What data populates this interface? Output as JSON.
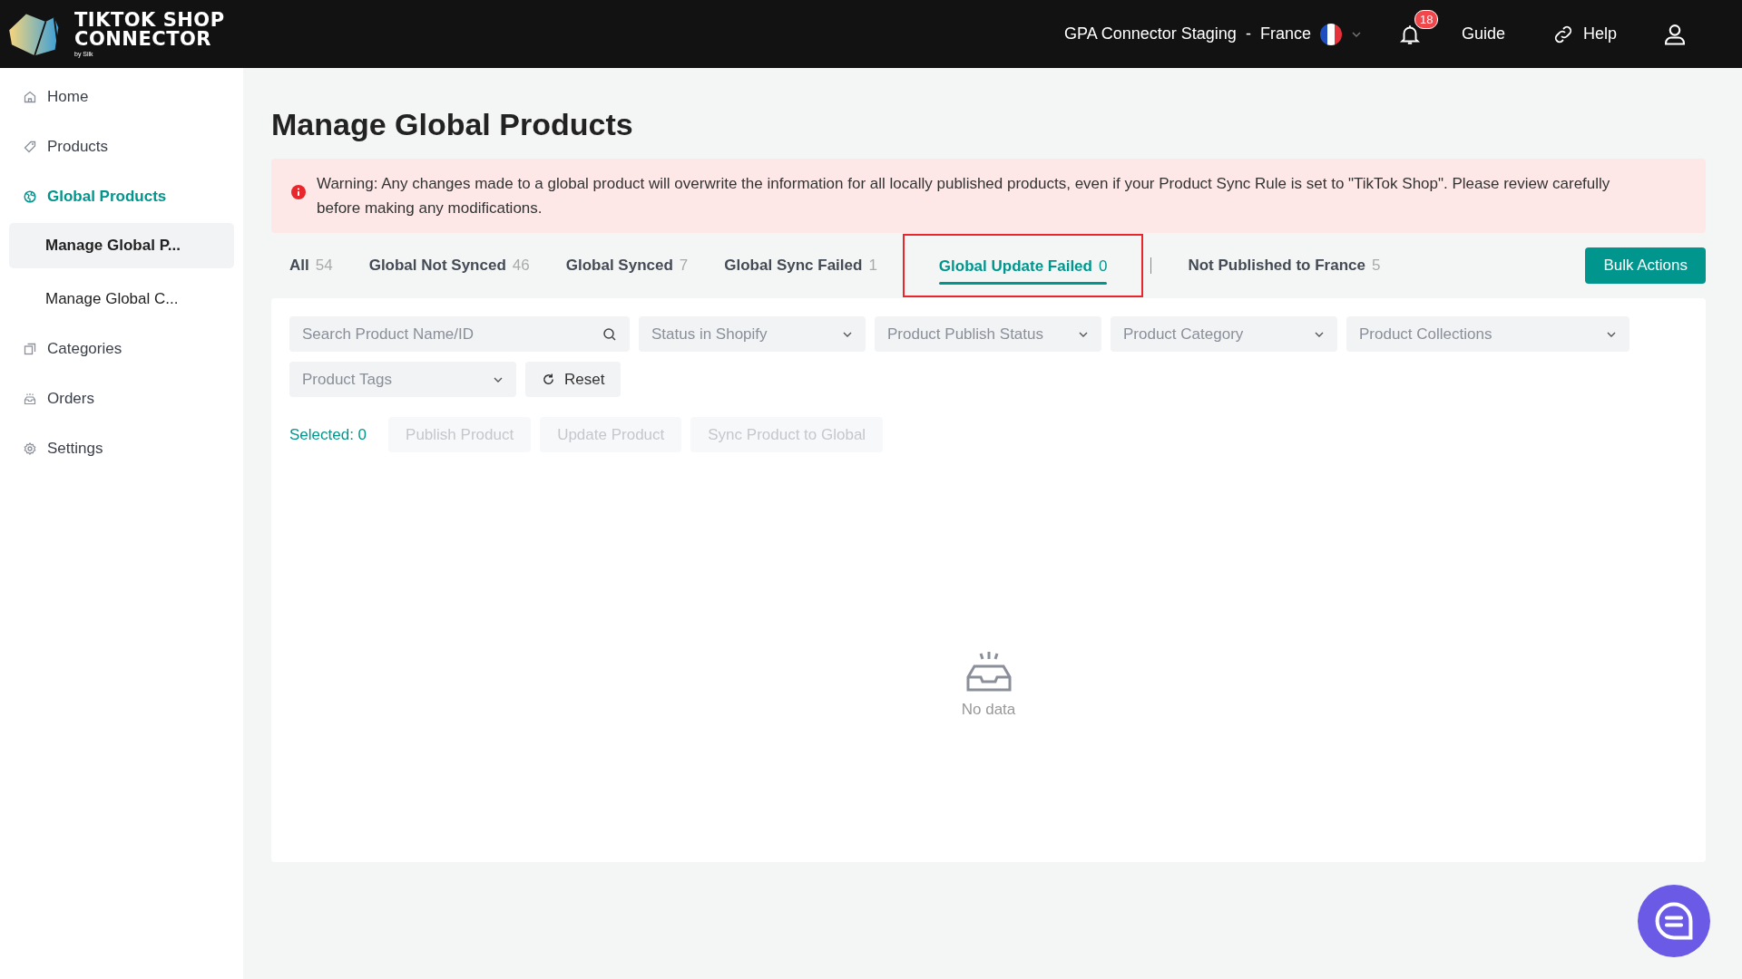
{
  "header": {
    "logo": {
      "line1": "TIKTOK SHOP",
      "line2": "CONNECTOR",
      "byline": "by Silk"
    },
    "store_selector": {
      "name": "GPA Connector Staging",
      "separator": "-",
      "country": "France"
    },
    "notifications": {
      "count": "18"
    },
    "guide": "Guide",
    "help": "Help"
  },
  "sidebar": {
    "items": [
      {
        "label": "Home",
        "selected": false
      },
      {
        "label": "Products",
        "selected": false
      },
      {
        "label": "Global Products",
        "selected": true,
        "children": [
          {
            "label": "Manage Global P...",
            "selected": true
          },
          {
            "label": "Manage Global C...",
            "selected": false
          }
        ]
      },
      {
        "label": "Categories",
        "selected": false
      },
      {
        "label": "Orders",
        "selected": false
      },
      {
        "label": "Settings",
        "selected": false
      }
    ]
  },
  "page": {
    "title": "Manage Global Products",
    "warning": "Warning: Any changes made to a global product will overwrite the information for all locally published products, even if your Product Sync Rule is set to \"TikTok Shop\". Please review carefully before making any modifications.",
    "tabs": [
      {
        "label": "All",
        "count": "54",
        "selected": false,
        "highlighted": false
      },
      {
        "label": "Global Not Synced",
        "count": "46",
        "selected": false,
        "highlighted": false
      },
      {
        "label": "Global Synced",
        "count": "7",
        "selected": false,
        "highlighted": false
      },
      {
        "label": "Global Sync Failed",
        "count": "1",
        "selected": false,
        "highlighted": false
      },
      {
        "label": "Global Update Failed",
        "count": "0",
        "selected": true,
        "highlighted": true
      },
      {
        "label": "Not Published to France",
        "count": "5",
        "selected": false,
        "highlighted": false
      }
    ],
    "bulk_actions": "Bulk Actions",
    "search": {
      "placeholder": "Search Product Name/ID"
    },
    "filters": [
      {
        "placeholder": "Status in Shopify"
      },
      {
        "placeholder": "Product Publish Status"
      },
      {
        "placeholder": "Product Category"
      },
      {
        "placeholder": "Product Collections"
      },
      {
        "placeholder": "Product Tags"
      }
    ],
    "reset": "Reset",
    "selected_count": "Selected: 0",
    "actions": [
      {
        "label": "Publish Product",
        "disabled": true
      },
      {
        "label": "Update Product",
        "disabled": true
      },
      {
        "label": "Sync Product to Global",
        "disabled": true
      }
    ],
    "empty": "No data"
  }
}
